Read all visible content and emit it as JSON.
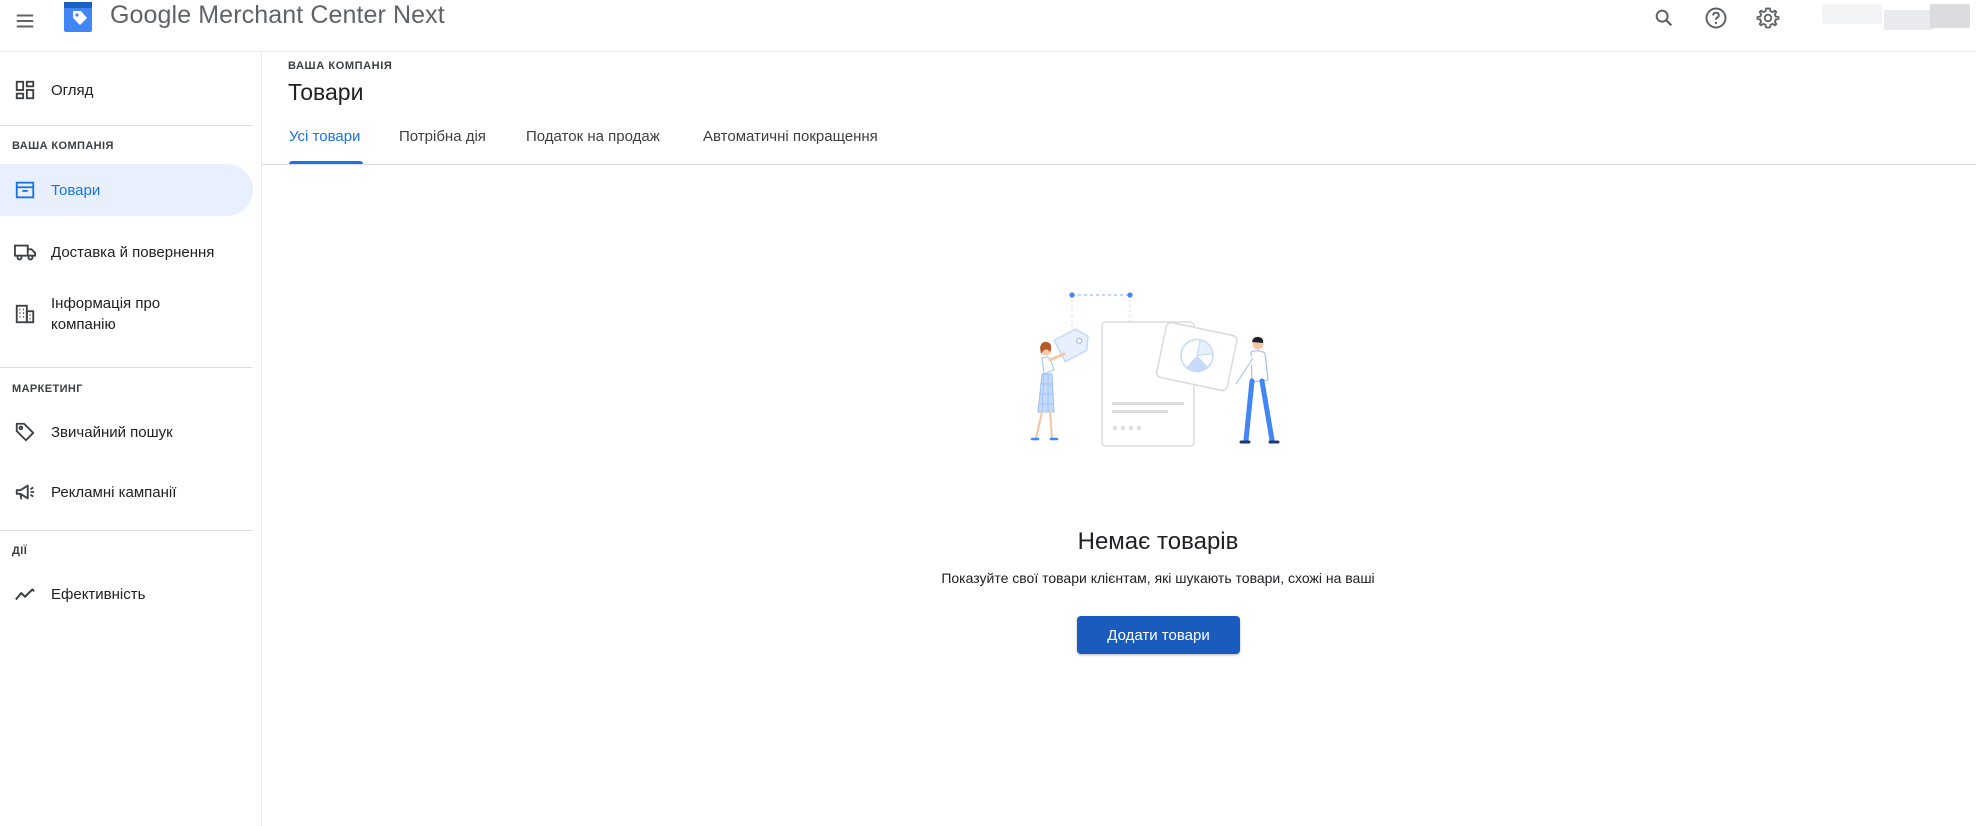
{
  "header": {
    "app_title": "Google Merchant Center Next",
    "icons": [
      "menu-icon",
      "search-icon",
      "help-icon",
      "settings-icon"
    ]
  },
  "sidebar": {
    "overview": {
      "label": "Огляд",
      "icon": "dashboard-icon"
    },
    "sections": [
      {
        "title": "ВАША КОМПАНІЯ",
        "items": [
          {
            "label": "Товари",
            "icon": "archive-box-icon",
            "active": true
          },
          {
            "label": "Доставка й повернення",
            "icon": "truck-icon"
          },
          {
            "label": "Інформація про компанію",
            "icon": "building-icon"
          }
        ]
      },
      {
        "title": "МАРКЕТИНГ",
        "items": [
          {
            "label": "Звичайний пошук",
            "icon": "tag-icon"
          },
          {
            "label": "Рекламні кампанії",
            "icon": "megaphone-icon"
          }
        ]
      },
      {
        "title": "ДІЇ",
        "items": [
          {
            "label": "Ефективність",
            "icon": "trending-icon"
          }
        ]
      }
    ]
  },
  "main": {
    "breadcrumb": "ВАША КОМПАНІЯ",
    "title": "Товари",
    "tabs": [
      {
        "label": "Усі товари",
        "active": true
      },
      {
        "label": "Потрібна дія"
      },
      {
        "label": "Податок на продаж"
      },
      {
        "label": "Автоматичні покращення"
      }
    ],
    "empty_state": {
      "title": "Немає товарів",
      "subtitle": "Показуйте свої товари клієнтам, які шукають товари, схожі на ваші",
      "button_label": "Додати товари"
    }
  },
  "colors": {
    "accent": "#1a73e8",
    "active_bg": "#e8f0fe",
    "primary_button": "#1a5cbd"
  }
}
